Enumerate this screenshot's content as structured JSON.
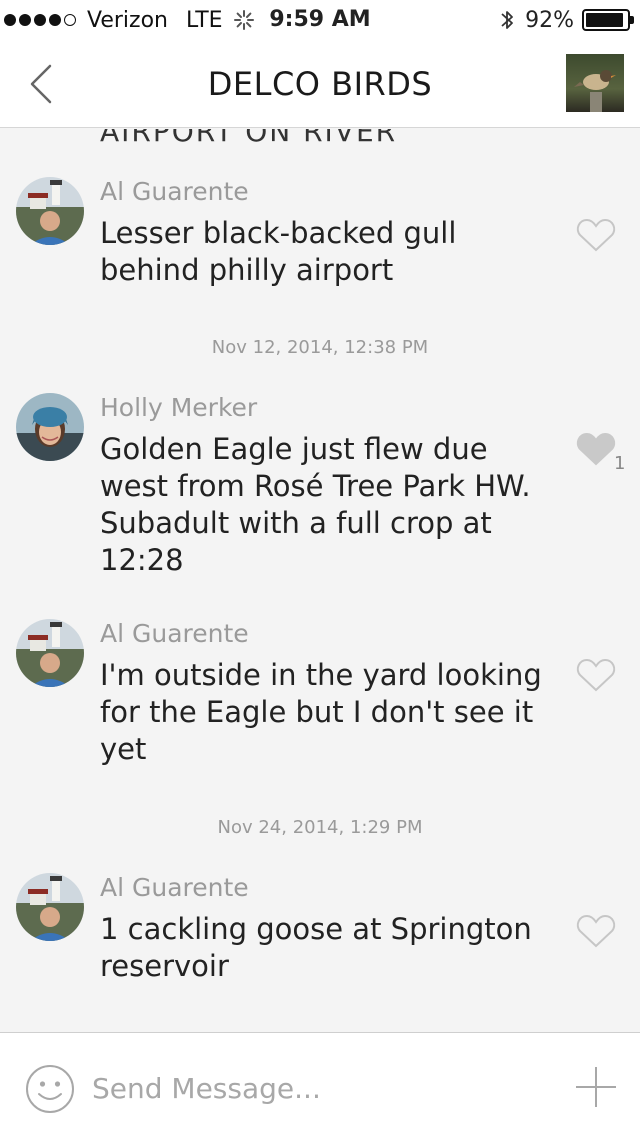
{
  "status_bar": {
    "carrier": "Verizon",
    "network": "LTE",
    "time": "9:59 AM",
    "battery": "92%",
    "battery_level": 0.92,
    "signal_bars": 4
  },
  "nav": {
    "title": "DELCO BIRDS"
  },
  "feed": {
    "cutoff_text": "AIRPORT ON RIVER",
    "messages": [
      {
        "author": "Al Guarente",
        "text": "Lesser black-backed gull behind philly airport",
        "liked": false
      },
      {
        "author": "Holly Merker",
        "text": "Golden Eagle just flew due west from Rosé Tree Park HW. Subadult with a full crop at 12:28",
        "liked": true,
        "likes": "1"
      },
      {
        "author": "Al Guarente",
        "text": "I'm outside in the yard looking for the Eagle but I don't see it yet",
        "liked": false
      },
      {
        "author": "Al Guarente",
        "text": "1 cackling goose at Springton reservoir",
        "liked": false
      }
    ],
    "timestamps": [
      "Nov 12, 2014, 12:38 PM",
      "Nov 24, 2014, 1:29 PM"
    ]
  },
  "composer": {
    "placeholder": "Send Message...",
    "value": ""
  },
  "icons": {
    "back": "chevron-left-icon",
    "like": "heart-icon",
    "emoji": "smiley-icon",
    "attach": "plus-icon",
    "bluetooth": "bluetooth-icon"
  },
  "colors": {
    "background": "#f4f4f4",
    "meta_text": "#9a9a9a",
    "liked_heart": "#c9c9c9"
  }
}
